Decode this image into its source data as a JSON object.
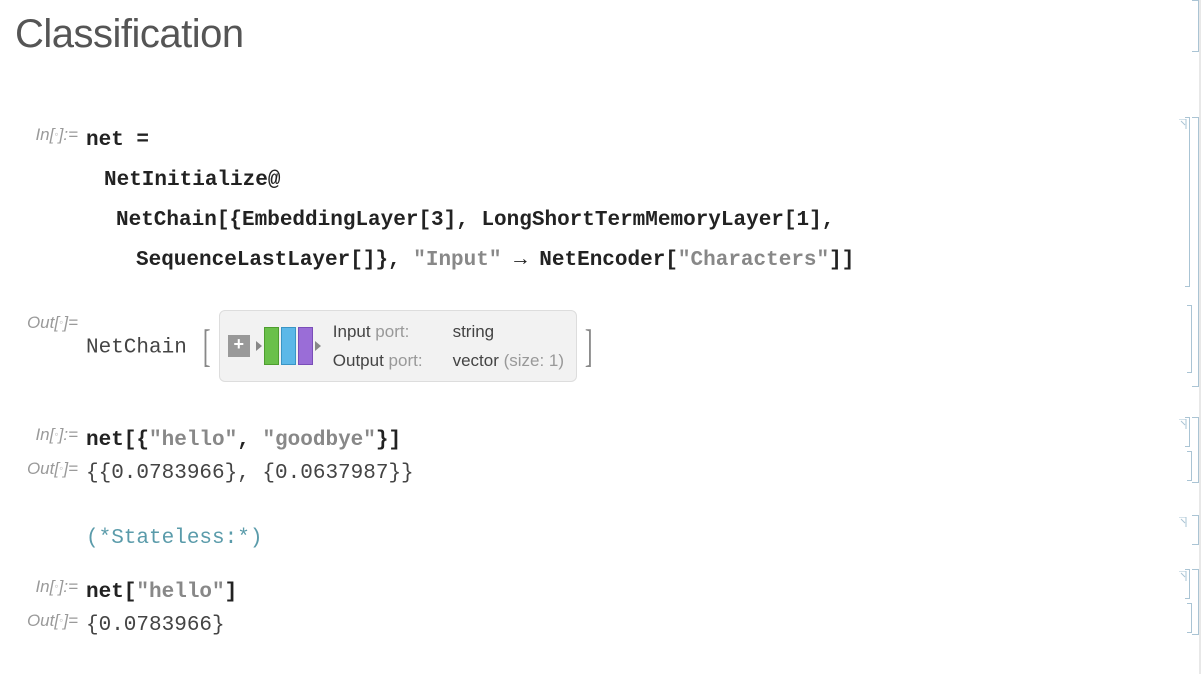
{
  "title": "Classification",
  "labels": {
    "in": "In[",
    "out": "Out[",
    "eqIn": "]:=",
    "eqOut": "]="
  },
  "cell1": {
    "line1_a": "net",
    "line1_b": " =",
    "line2": "NetInitialize@",
    "line3_a": "NetChain[{EmbeddingLayer[3], LongShortTermMemoryLayer[1],",
    "line4_a": "SequenceLastLayer[]}, ",
    "line4_str1": "\"Input\"",
    "line4_arrow": " → ",
    "line4_b": "NetEncoder[",
    "line4_str2": "\"Characters\"",
    "line4_c": "]]"
  },
  "out1": {
    "prefix": "NetChain",
    "inputPortLabel": "Input",
    "outputPortLabel": "Output",
    "portSuffix": " port:",
    "inputPortValue": "string",
    "outputPortValue_a": "vector",
    "outputPortValue_b": " (size: 1)"
  },
  "cell2": {
    "code_a": "net[{",
    "str1": "\"hello\"",
    "sep": ", ",
    "str2": "\"goodbye\"",
    "code_b": "}]"
  },
  "out2": {
    "text": "{{0.0783966}, {0.0637987}}"
  },
  "comment": "(*Stateless:*)",
  "cell3": {
    "code_a": "net[",
    "str1": "\"hello\"",
    "code_b": "]"
  },
  "out3": {
    "text": "{0.0783966}"
  }
}
